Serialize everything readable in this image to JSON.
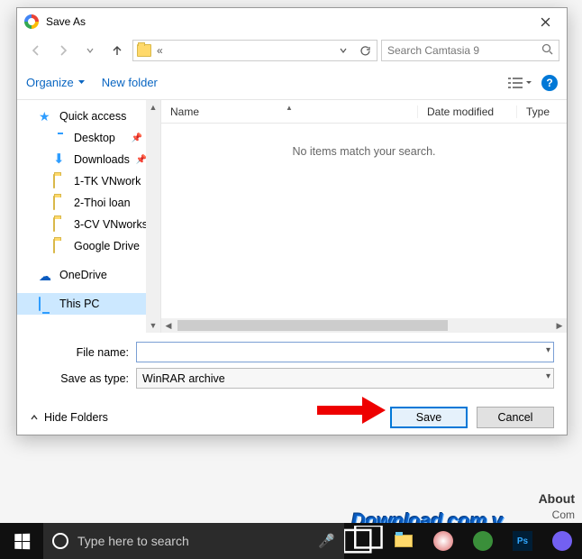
{
  "window": {
    "title": "Save As"
  },
  "nav": {
    "breadcrumb": "«",
    "searchPlaceholder": "Search Camtasia 9"
  },
  "toolbar": {
    "organize": "Organize",
    "newFolder": "New folder"
  },
  "tree": {
    "quickAccess": "Quick access",
    "items": [
      {
        "label": "Desktop",
        "icon": "monitor",
        "pinned": true
      },
      {
        "label": "Downloads",
        "icon": "dlarrow",
        "pinned": true
      },
      {
        "label": "1-TK VNwork",
        "icon": "folder",
        "pinned": false
      },
      {
        "label": "2-Thoi loan",
        "icon": "folder",
        "pinned": false
      },
      {
        "label": "3-CV VNworks",
        "icon": "folder",
        "pinned": false
      },
      {
        "label": "Google Drive",
        "icon": "folder",
        "pinned": false
      }
    ],
    "oneDrive": "OneDrive",
    "thisPC": "This PC"
  },
  "columns": {
    "name": "Name",
    "dateModified": "Date modified",
    "type": "Type"
  },
  "empty": "No items match your search.",
  "form": {
    "fileNameLabel": "File name:",
    "fileNameValue": "",
    "saveTypeLabel": "Save as type:",
    "saveTypeValue": "WinRAR archive"
  },
  "buttons": {
    "hideFolders": "Hide Folders",
    "save": "Save",
    "cancel": "Cancel"
  },
  "taskbar": {
    "searchPlaceholder": "Type here to search"
  },
  "page": {
    "about": "About",
    "com": "Com",
    "watermark": "Download.com.v"
  }
}
